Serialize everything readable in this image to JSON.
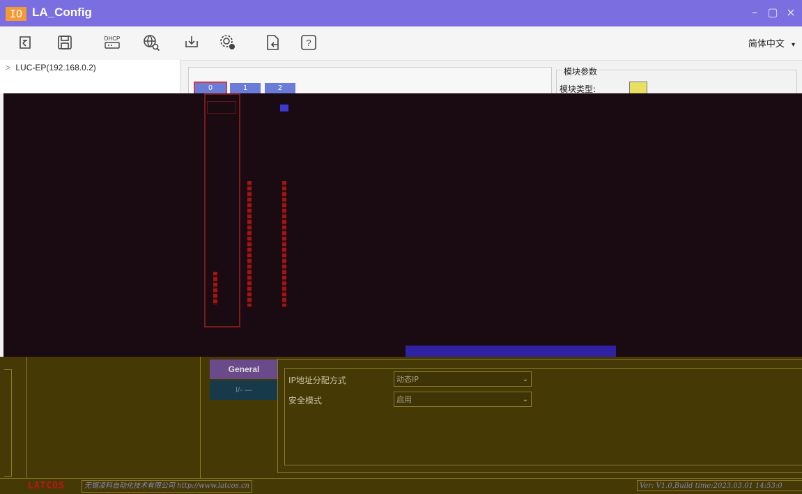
{
  "window": {
    "app_badge": "IO",
    "title": "LA_Config",
    "minimize_glyph": "–",
    "maximize_glyph": "▢",
    "close_glyph": "×"
  },
  "toolbar": {
    "icons": [
      "import-icon",
      "save-icon",
      "dhcp-icon",
      "network-search-icon",
      "download-icon",
      "settings-icon",
      "export-icon",
      "help-icon"
    ],
    "dhcp_text": "DHCP",
    "help_text": "?",
    "language": "简体中文",
    "language_chevron": "▾"
  },
  "tree": {
    "expand_glyph": ">",
    "root_label": "LUC-EP(192.168.0.2)"
  },
  "rack": {
    "slots": [
      "0",
      "1",
      "2"
    ]
  },
  "module_params": {
    "group_title": "模块参数",
    "type_label": "模块类型:"
  },
  "config": {
    "tabs": {
      "general": "General",
      "io": "I/- —"
    },
    "properties": [
      {
        "label": "IP地址分配方式",
        "value": "动态IP"
      },
      {
        "label": "安全模式",
        "value": "启用"
      }
    ]
  },
  "footer": {
    "logo": "LATCOS",
    "company": "无锡凌科自动化技术有限公司 http://www.latcos.cn",
    "version": "Ver: V1.0,Build time:2023.03.01 14:53:0"
  },
  "colors": {
    "titlebar": "#7a6ee0",
    "badge": "#f39a32",
    "dark_band": "#1a0a12",
    "lower_panel": "#453a06"
  }
}
